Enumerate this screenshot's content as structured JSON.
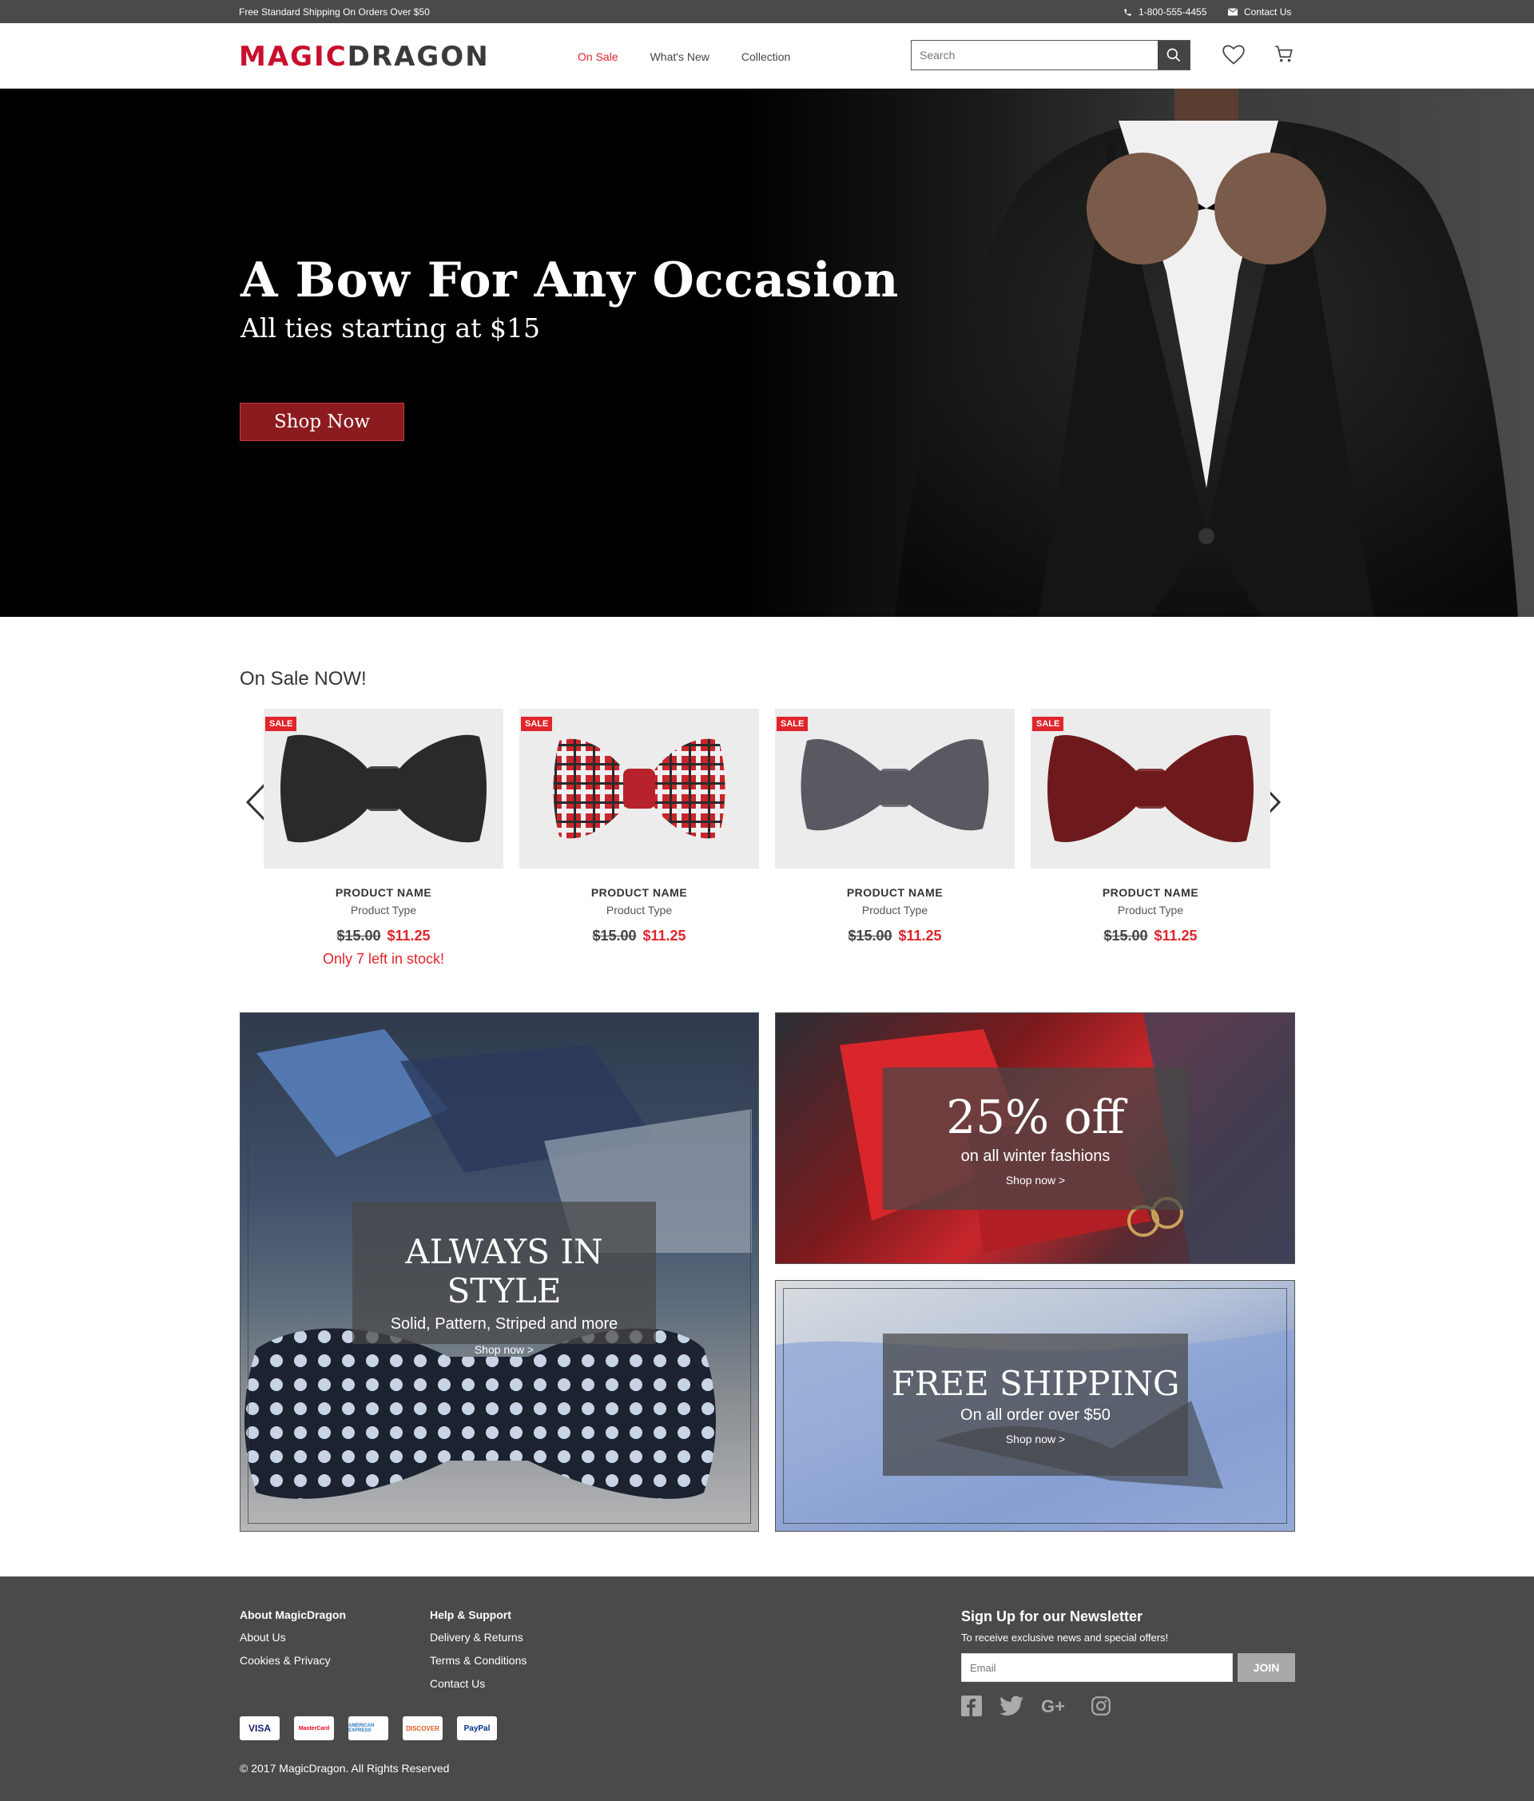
{
  "topbar": {
    "shipping": "Free Standard Shipping On Orders Over $50",
    "phone": "1-800-555-4455",
    "contact": "Contact Us"
  },
  "header": {
    "logo_part1": "MAGIC",
    "logo_part2": "DRAGON",
    "nav": [
      {
        "label": "On Sale",
        "active": true
      },
      {
        "label": "What's New",
        "active": false
      },
      {
        "label": "Collection",
        "active": false
      }
    ],
    "search_placeholder": "Search",
    "icons": [
      "search-icon",
      "heart-icon",
      "cart-icon"
    ]
  },
  "hero": {
    "title": "A Bow For Any Occasion",
    "subtitle": "All ties starting at $15",
    "cta": "Shop Now"
  },
  "sale": {
    "title": "On Sale NOW!",
    "products": [
      {
        "badge": "SALE",
        "name": "PRODUCT NAME",
        "type": "Product Type",
        "old_price": "$15.00",
        "new_price": "$11.25",
        "stock": "Only 7 left in stock!",
        "color": "#2a2a2a"
      },
      {
        "badge": "SALE",
        "name": "PRODUCT NAME",
        "type": "Product Type",
        "old_price": "$15.00",
        "new_price": "$11.25",
        "stock": "",
        "color": "#c8262b"
      },
      {
        "badge": "SALE",
        "name": "PRODUCT NAME",
        "type": "Product Type",
        "old_price": "$15.00",
        "new_price": "$11.25",
        "stock": "",
        "color": "#5a5860"
      },
      {
        "badge": "SALE",
        "name": "PRODUCT NAME",
        "type": "Product Type",
        "old_price": "$15.00",
        "new_price": "$11.25",
        "stock": "",
        "color": "#6e1a1c"
      }
    ]
  },
  "promos": {
    "style": {
      "title": "ALWAYS IN STYLE",
      "sub": "Solid, Pattern, Striped and more",
      "link": "Shop now >"
    },
    "discount": {
      "title": "25% off",
      "sub": "on all winter fashions",
      "link": "Shop now >"
    },
    "shipping": {
      "title": "FREE SHIPPING",
      "sub": "On all order over $50",
      "link": "Shop now >"
    }
  },
  "footer": {
    "about": {
      "heading": "About MagicDragon",
      "links": [
        "About Us",
        "Cookies & Privacy"
      ]
    },
    "help": {
      "heading": "Help & Support",
      "links": [
        "Delivery & Returns",
        "Terms & Conditions",
        "Contact Us"
      ]
    },
    "newsletter": {
      "heading": "Sign Up for our Newsletter",
      "desc": "To receive exclusive news and special offers!",
      "placeholder": "Email",
      "button": "JOIN"
    },
    "payments": [
      "VISA",
      "MasterCard",
      "AMERICAN EXPRESS",
      "DISCOVER",
      "PayPal"
    ],
    "social": [
      "facebook-icon",
      "twitter-icon",
      "google-plus-icon",
      "instagram-icon"
    ],
    "copyright": "© 2017 MagicDragon. All Rights Reserved"
  }
}
